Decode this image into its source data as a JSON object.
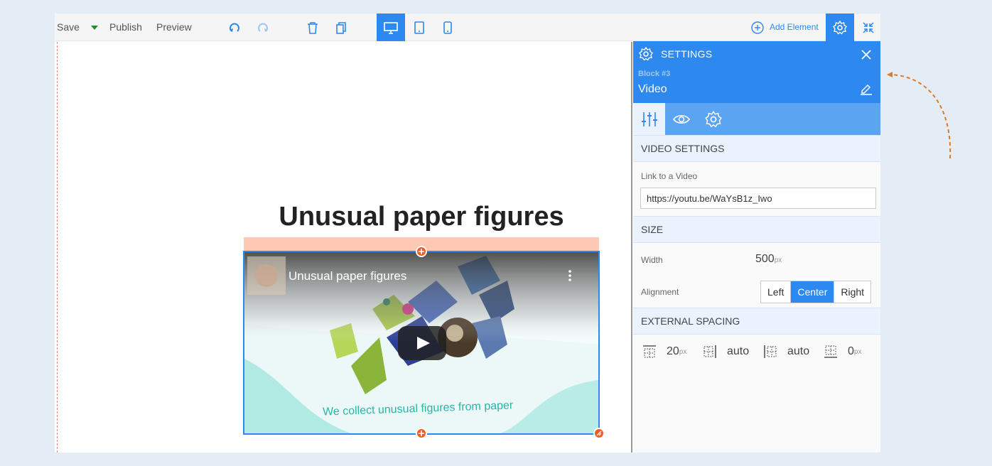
{
  "toolbar": {
    "save_label": "Save",
    "publish_label": "Publish",
    "preview_label": "Preview",
    "add_element_label": "Add Element"
  },
  "canvas": {
    "page_title": "Unusual paper figures",
    "video": {
      "title": "Unusual paper figures",
      "caption": "We collect unusual figures from paper"
    }
  },
  "settings": {
    "title": "SETTINGS",
    "block_number": "Block #3",
    "block_name": "Video",
    "sections": {
      "video_settings": "VIDEO SETTINGS",
      "size": "SIZE",
      "external_spacing": "EXTERNAL SPACING"
    },
    "link_label": "Link to a Video",
    "link_value": "https://youtu.be/WaYsB1z_Iwo",
    "width_label": "Width",
    "width_value": "500",
    "width_unit": "px",
    "alignment_label": "Alignment",
    "alignment_options": [
      "Left",
      "Center",
      "Right"
    ],
    "alignment_selected": "Center",
    "spacing": {
      "top": "20",
      "top_unit": "px",
      "left": "auto",
      "right": "auto",
      "bottom": "0",
      "bottom_unit": "px"
    }
  },
  "colors": {
    "accent": "#2d89ef",
    "handle": "#f15a24",
    "spacing_highlight": "#fdc8b4",
    "annotation_arrow": "#e07a20"
  }
}
